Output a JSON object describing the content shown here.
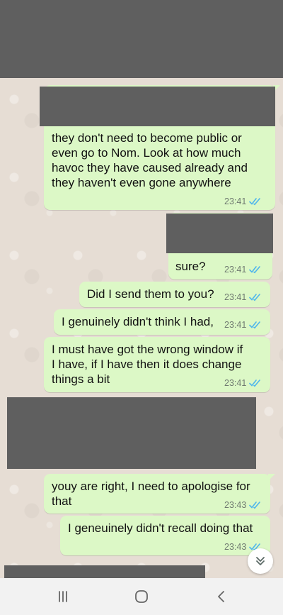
{
  "messages": [
    {
      "text": "they don't need to become public or\neven go to Nom. Look at how much\nhavoc they have caused already and\nthey haven't even gone anywhere",
      "time": "23:41"
    },
    {
      "text": "sure?",
      "time": "23:41"
    },
    {
      "text": "Did I send them to you?",
      "time": "23:41"
    },
    {
      "text": "I genuinely didn't think I had,",
      "time": "23:41"
    },
    {
      "text": "I must have got the wrong window if\nI have, if I have then it does change\nthings a bit",
      "time": "23:41"
    },
    {
      "text": "youy are right, I need to apologise for\nthat",
      "time": "23:43"
    },
    {
      "text": "I geneuinely didn't recall doing that",
      "time": "23:43"
    }
  ],
  "colors": {
    "outgoing_bubble": "#dcf8c6",
    "read_ticks": "#4fb6ec",
    "redaction": "#5f5f5f"
  },
  "icons": {
    "read_receipt": "double-check-icon",
    "scroll_down": "chevron-double-down-icon",
    "nav_recents": "recents-icon",
    "nav_home": "home-icon",
    "nav_back": "back-icon"
  }
}
